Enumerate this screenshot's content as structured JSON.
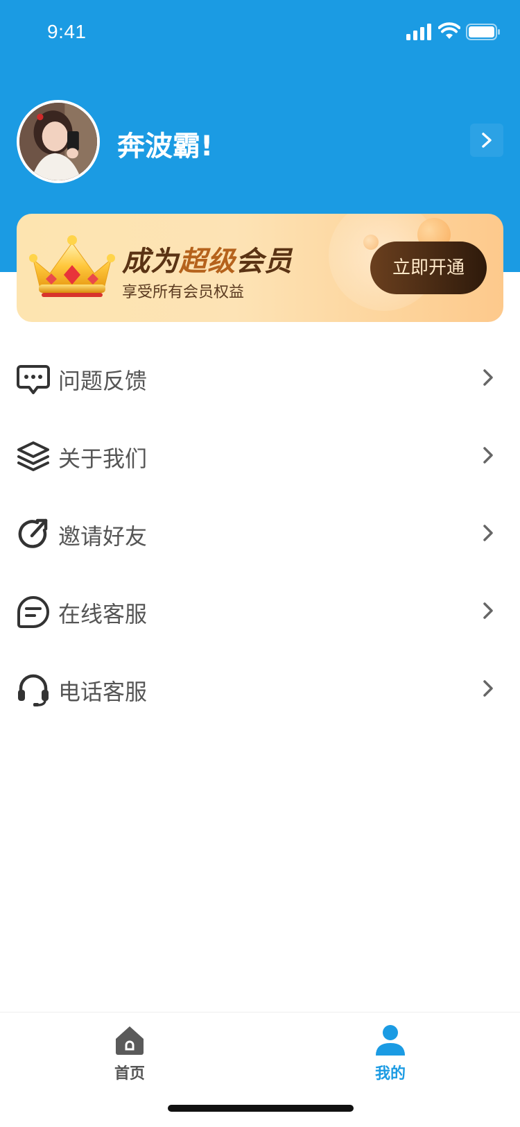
{
  "status_bar": {
    "time": "9:41"
  },
  "profile": {
    "username": "奔波霸!"
  },
  "vip_banner": {
    "title_part1": "成为",
    "title_part2": "超级",
    "title_part3": "会员",
    "subtitle": "享受所有会员权益",
    "button_label": "立即开通"
  },
  "menu": {
    "items": [
      {
        "label": "问题反馈",
        "icon": "feedback-icon"
      },
      {
        "label": "关于我们",
        "icon": "layers-icon"
      },
      {
        "label": "邀请好友",
        "icon": "share-icon"
      },
      {
        "label": "在线客服",
        "icon": "chat-icon"
      },
      {
        "label": "电话客服",
        "icon": "headset-icon"
      }
    ]
  },
  "tabbar": {
    "tabs": [
      {
        "label": "首页",
        "icon": "home-icon",
        "active": false
      },
      {
        "label": "我的",
        "icon": "user-icon",
        "active": true
      }
    ]
  },
  "colors": {
    "primary": "#1b9be3",
    "menu_text": "#555555",
    "vip_gold": "#fde3b5",
    "vip_button": "#3a220f"
  }
}
